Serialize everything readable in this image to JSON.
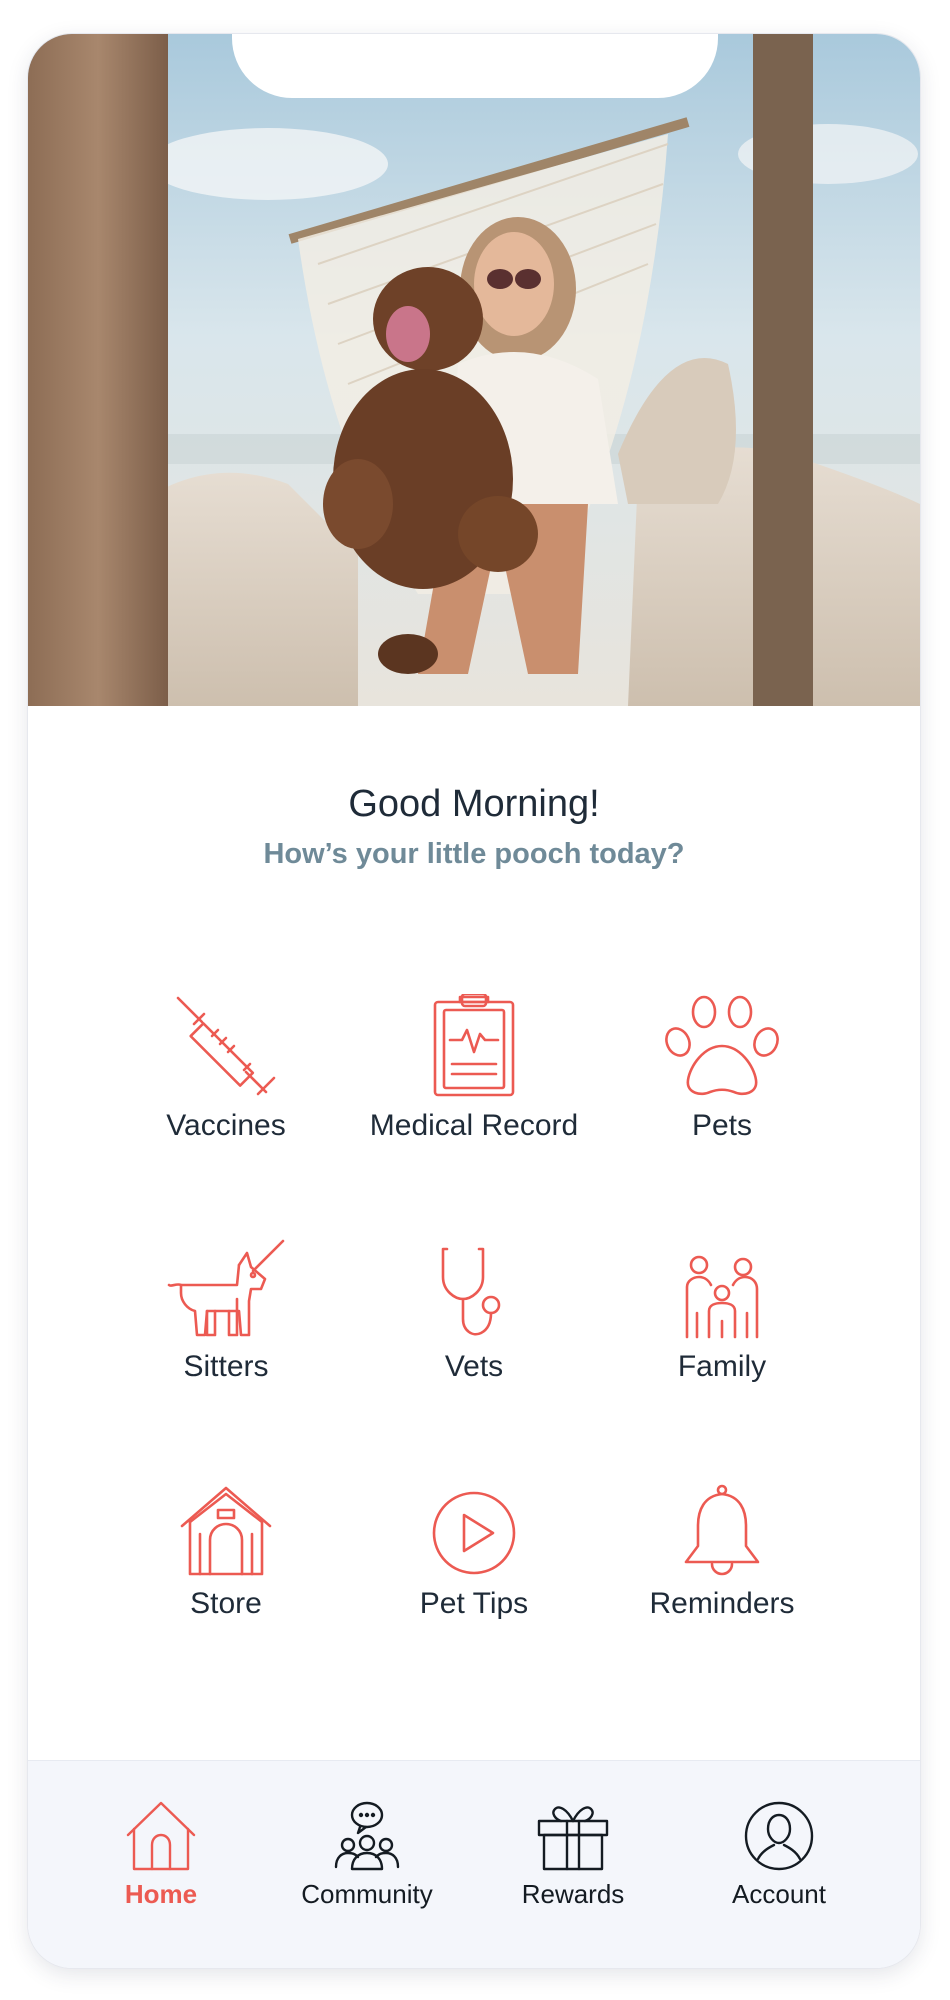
{
  "colors": {
    "accent": "#ec5a52",
    "subtitle": "#6f8a98",
    "text": "#1f2b38",
    "tabbar_bg": "#f4f6fb"
  },
  "hero": {
    "image": "photo of a smiling woman in a hanging macrame chair holding a brown curly-haired dog"
  },
  "greeting": {
    "title": "Good Morning!",
    "subtitle": "How’s your little pooch today?"
  },
  "menu": [
    {
      "label": "Vaccines",
      "icon": "syringe-icon"
    },
    {
      "label": "Medical Record",
      "icon": "clipboard-icon"
    },
    {
      "label": "Pets",
      "icon": "paw-icon"
    },
    {
      "label": "Sitters",
      "icon": "dog-leash-icon"
    },
    {
      "label": "Vets",
      "icon": "stethoscope-icon"
    },
    {
      "label": "Family",
      "icon": "family-icon"
    },
    {
      "label": "Store",
      "icon": "dog-house-icon"
    },
    {
      "label": "Pet Tips",
      "icon": "play-icon"
    },
    {
      "label": "Reminders",
      "icon": "bell-icon"
    }
  ],
  "tabbar": {
    "active": "Home",
    "items": [
      {
        "label": "Home",
        "icon": "home-icon"
      },
      {
        "label": "Community",
        "icon": "community-icon"
      },
      {
        "label": "Rewards",
        "icon": "gift-icon"
      },
      {
        "label": "Account",
        "icon": "account-icon"
      }
    ]
  }
}
